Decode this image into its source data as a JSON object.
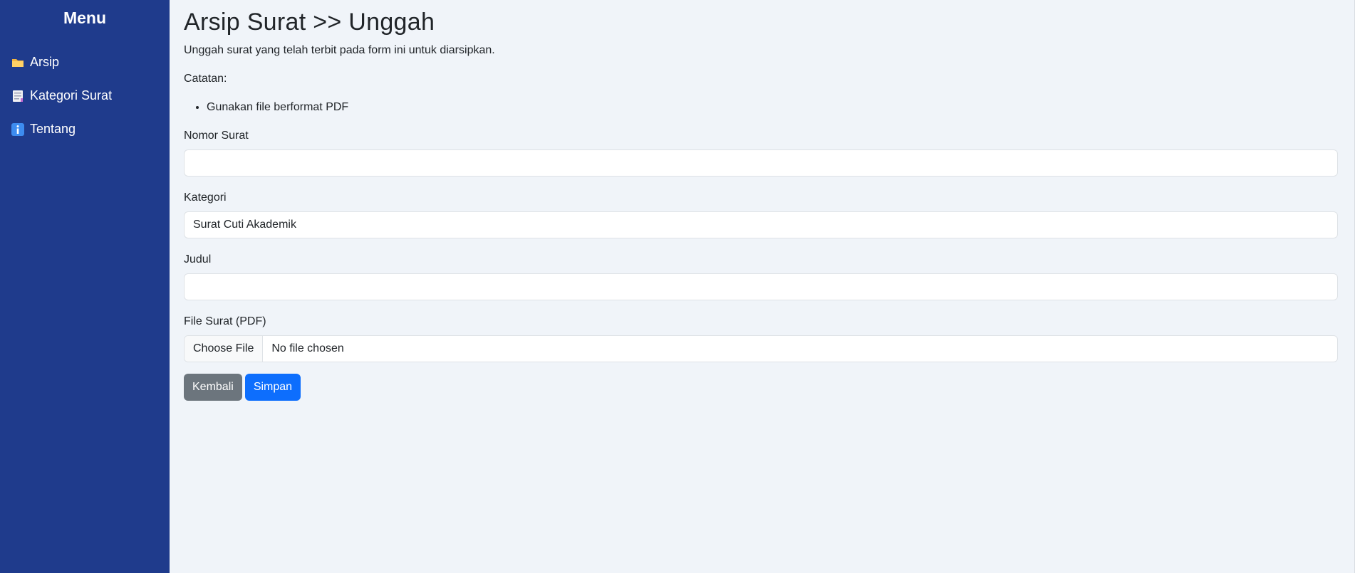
{
  "sidebar": {
    "title": "Menu",
    "items": [
      {
        "label": "Arsip",
        "icon": "folder-icon"
      },
      {
        "label": "Kategori Surat",
        "icon": "document-icon"
      },
      {
        "label": "Tentang",
        "icon": "info-icon"
      }
    ]
  },
  "page": {
    "title": "Arsip Surat >> Unggah",
    "subtitle": "Unggah surat yang telah terbit pada form ini untuk diarsipkan.",
    "notes_label": "Catatan:",
    "notes": [
      "Gunakan file berformat PDF"
    ]
  },
  "form": {
    "nomor_surat": {
      "label": "Nomor Surat",
      "value": ""
    },
    "kategori": {
      "label": "Kategori",
      "value": "Surat Cuti Akademik"
    },
    "judul": {
      "label": "Judul",
      "value": ""
    },
    "file": {
      "label": "File Surat (PDF)",
      "button_label": "Choose File",
      "status": "No file chosen"
    }
  },
  "actions": {
    "back_label": "Kembali",
    "save_label": "Simpan"
  },
  "colors": {
    "sidebar_bg": "#1f3b8c",
    "page_bg": "#f0f4f9",
    "primary": "#0d6efd",
    "secondary": "#6c757d"
  }
}
